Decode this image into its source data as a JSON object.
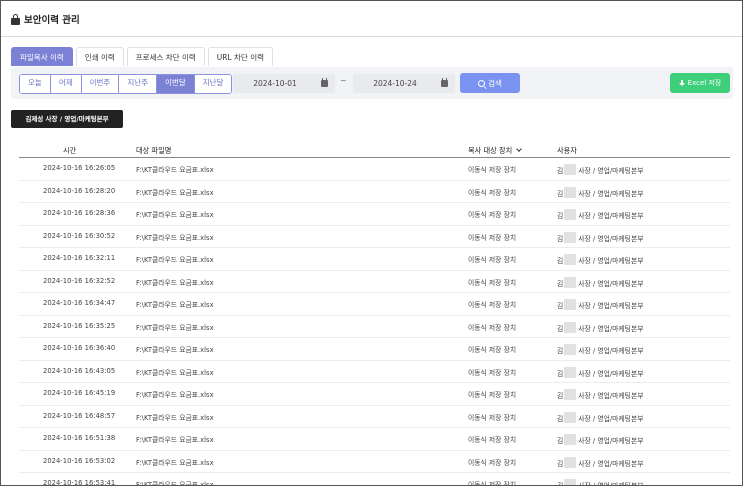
{
  "header": {
    "title": "보안이력 관리"
  },
  "tabs": [
    {
      "label": "파일복사 이력",
      "active": true
    },
    {
      "label": "인쇄 이력",
      "active": false
    },
    {
      "label": "프로세스 차단 이력",
      "active": false
    },
    {
      "label": "URL 차단 이력",
      "active": false
    }
  ],
  "periods": [
    {
      "label": "오늘",
      "active": false
    },
    {
      "label": "어제",
      "active": false
    },
    {
      "label": "이번주",
      "active": false
    },
    {
      "label": "지난주",
      "active": false
    },
    {
      "label": "이번달",
      "active": true
    },
    {
      "label": "지난달",
      "active": false
    }
  ],
  "filter": {
    "start_date": "2024-10-01",
    "end_date": "2024-10-24",
    "separator": "~",
    "search_label": "검색",
    "excel_label": "Excel 저장"
  },
  "user_chip": "김제성 사장 / 영업/마케팅본부",
  "table": {
    "headers": {
      "time": "시간",
      "file": "대상 파일명",
      "device": "복사 대상 장치",
      "user": "사용자"
    },
    "rows": [
      {
        "time": "2024-10-16 16:26:05",
        "file": "F:\\KT클라우드 요금표.xlsx",
        "device": "이동식 저장 장치",
        "user_prefix": "김",
        "user_suffix": "사장 / 영업/마케팅본부"
      },
      {
        "time": "2024-10-16 16:28:20",
        "file": "F:\\KT클라우드 요금표.xlsx",
        "device": "이동식 저장 장치",
        "user_prefix": "김",
        "user_suffix": "사장 / 영업/마케팅본부"
      },
      {
        "time": "2024-10-16 16:28:36",
        "file": "F:\\KT클라우드 요금표.xlsx",
        "device": "이동식 저장 장치",
        "user_prefix": "김",
        "user_suffix": "사장 / 영업/마케팅본부"
      },
      {
        "time": "2024-10-16 16:30:52",
        "file": "F:\\KT클라우드 요금표.xlsx",
        "device": "이동식 저장 장치",
        "user_prefix": "김",
        "user_suffix": "사장 / 영업/마케팅본부"
      },
      {
        "time": "2024-10-16 16:32:11",
        "file": "F:\\KT클라우드 요금표.xlsx",
        "device": "이동식 저장 장치",
        "user_prefix": "김",
        "user_suffix": "사장 / 영업/마케팅본부"
      },
      {
        "time": "2024-10-16 16:32:52",
        "file": "F:\\KT클라우드 요금표.xlsx",
        "device": "이동식 저장 장치",
        "user_prefix": "김",
        "user_suffix": "사장 / 영업/마케팅본부"
      },
      {
        "time": "2024-10-16 16:34:47",
        "file": "F:\\KT클라우드 요금표.xlsx",
        "device": "이동식 저장 장치",
        "user_prefix": "김",
        "user_suffix": "사장 / 영업/마케팅본부"
      },
      {
        "time": "2024-10-16 16:35:25",
        "file": "F:\\KT클라우드 요금표.xlsx",
        "device": "이동식 저장 장치",
        "user_prefix": "김",
        "user_suffix": "사장 / 영업/마케팅본부"
      },
      {
        "time": "2024-10-16 16:36:40",
        "file": "F:\\KT클라우드 요금표.xlsx",
        "device": "이동식 저장 장치",
        "user_prefix": "김",
        "user_suffix": "사장 / 영업/마케팅본부"
      },
      {
        "time": "2024-10-16 16:43:05",
        "file": "F:\\KT클라우드 요금표.xlsx",
        "device": "이동식 저장 장치",
        "user_prefix": "김",
        "user_suffix": "사장 / 영업/마케팅본부"
      },
      {
        "time": "2024-10-16 16:45:19",
        "file": "F:\\KT클라우드 요금표.xlsx",
        "device": "이동식 저장 장치",
        "user_prefix": "김",
        "user_suffix": "사장 / 영업/마케팅본부"
      },
      {
        "time": "2024-10-16 16:48:57",
        "file": "F:\\KT클라우드 요금표.xlsx",
        "device": "이동식 저장 장치",
        "user_prefix": "김",
        "user_suffix": "사장 / 영업/마케팅본부"
      },
      {
        "time": "2024-10-16 16:51:38",
        "file": "F:\\KT클라우드 요금표.xlsx",
        "device": "이동식 저장 장치",
        "user_prefix": "김",
        "user_suffix": "사장 / 영업/마케팅본부"
      },
      {
        "time": "2024-10-16 16:53:02",
        "file": "F:\\KT클라우드 요금표.xlsx",
        "device": "이동식 저장 장치",
        "user_prefix": "김",
        "user_suffix": "사장 / 영업/마케팅본부"
      },
      {
        "time": "2024-10-16 16:53:41",
        "file": "F:\\KT클라우드 요금표.xlsx",
        "device": "이동식 저장 장치",
        "user_prefix": "김",
        "user_suffix": "사장 / 영업/마케팅본부"
      }
    ]
  },
  "colors": {
    "accent": "#7b82d6",
    "search_button": "#7b93f0",
    "excel_button": "#3ecf7a",
    "user_chip": "#222222"
  }
}
